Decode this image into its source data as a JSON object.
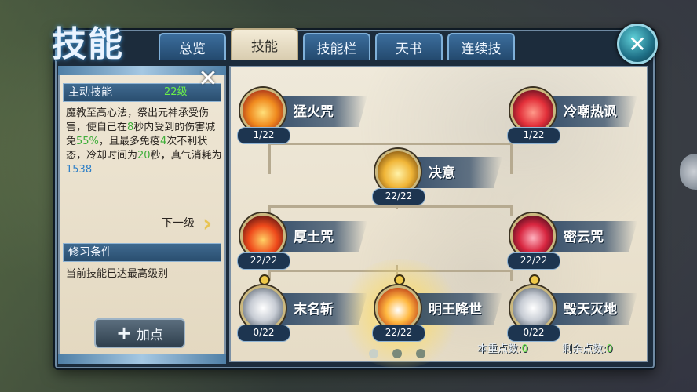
{
  "window": {
    "title": "技能"
  },
  "tabs": [
    {
      "label": "总览",
      "active": false
    },
    {
      "label": "技能",
      "active": true
    },
    {
      "label": "技能栏",
      "active": false
    },
    {
      "label": "天书",
      "active": false
    },
    {
      "label": "连续技",
      "active": false
    }
  ],
  "close_icon": "close-x-icon",
  "left_panel": {
    "active_header": "主动技能",
    "level": "22级",
    "desc_parts": [
      "魔教至高心法，祭出元神承受伤害，使自己在",
      "8",
      "秒内受到的伤害减免",
      "55%",
      "，且最多免疫",
      "4",
      "次不利状态，冷却时间为",
      "20",
      "秒，真气消耗为",
      "1538"
    ],
    "next_level": "下一级",
    "req_header": "修习条件",
    "req_text": "当前技能已达最高级别",
    "add_button": "加点"
  },
  "skills": [
    {
      "name": "猛火咒",
      "count": "1/22",
      "icon": "fire-icon"
    },
    {
      "name": "冷嘲热讽",
      "count": "1/22",
      "icon": "red-flame-icon"
    },
    {
      "name": "决意",
      "count": "22/22",
      "icon": "gold-shield-icon"
    },
    {
      "name": "厚土咒",
      "count": "22/22",
      "icon": "flame-demon-icon"
    },
    {
      "name": "密云咒",
      "count": "22/22",
      "icon": "red-shield-icon"
    },
    {
      "name": "末名斩",
      "count": "0/22",
      "icon": "silver-slash-icon"
    },
    {
      "name": "明王降世",
      "count": "22/22",
      "icon": "sun-avatar-icon"
    },
    {
      "name": "毁天灭地",
      "count": "0/22",
      "icon": "silver-blast-icon"
    }
  ],
  "points": {
    "reset_label": "本重点数:",
    "reset_value": "0",
    "remaining_label": "剩余点数:",
    "remaining_value": "0"
  }
}
